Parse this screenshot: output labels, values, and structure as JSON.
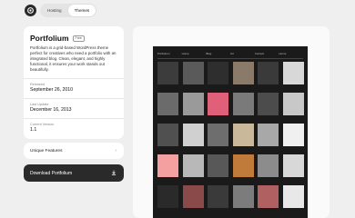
{
  "nav": {
    "tabs": [
      {
        "label": "Hosting",
        "active": false
      },
      {
        "label": "Themes",
        "active": true
      }
    ]
  },
  "theme": {
    "title": "Portfolium",
    "badge": "Free",
    "description": "Portfolium is a grid-based WordPress theme perfect for creatives who need a portfolio with an integrated blog. Clean, elegant, and highly functional, it ensures your work stands out beautifully.",
    "released_label": "Released",
    "released_value": "September 26, 2010",
    "updated_label": "Last Update",
    "updated_value": "December 16, 2013",
    "version_label": "Current Version",
    "version_value": "1.1"
  },
  "features": {
    "label": "Unique Features"
  },
  "download": {
    "label": "Download Portfolium"
  },
  "preview": {
    "nav_items": [
      "Portfolium",
      "Home",
      "Blog",
      "Art",
      "Contact",
      "Home"
    ],
    "tiles": [
      [
        "#3c3c3c",
        "#5a5a5a",
        "#2e2e2e",
        "#8a7a6a",
        "#3a3a3a",
        "#d8d8d8"
      ],
      [
        "#6b6b6b",
        "#9a9a9a",
        "#e0607a",
        "#7a7a7a",
        "#4c4c4c",
        "#c8c8c8"
      ],
      [
        "#505050",
        "#d0d0d0",
        "#6e6e6e",
        "#c9b89a",
        "#a8a8a8",
        "#f0f0f0"
      ],
      [
        "#f4a0a0",
        "#b8b8b8",
        "#585858",
        "#c07a3a",
        "#8c8c8c",
        "#d8d8d8"
      ],
      [
        "#2a2a2a",
        "#8a4a4a",
        "#3a3a3a",
        "#7c7c7c",
        "#b06060",
        "#e8e8e8"
      ]
    ]
  },
  "colors": {
    "dark": "#2a2a2a",
    "bg": "#efefef",
    "card": "#ffffff"
  }
}
